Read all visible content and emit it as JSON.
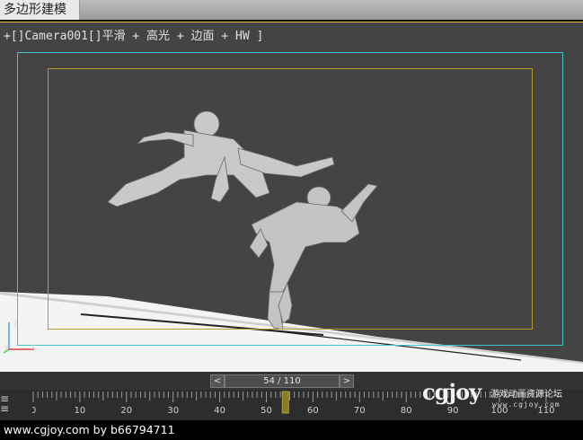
{
  "ribbon": {
    "active_tab": "多边形建模"
  },
  "viewport": {
    "label": "+[]Camera001[]平滑 + 高光 + 边面 + HW ]",
    "safe_frame_color": "#3fc3cf",
    "action_safe_color": "#b59a2e",
    "axes": {
      "z": "z",
      "y": "y",
      "x": "x"
    }
  },
  "timeline": {
    "prev_label": "<",
    "slider_text": "54 / 110",
    "next_label": ">",
    "current_frame": 54,
    "total_frames": 110,
    "ruler_numbers": [
      "0",
      "10",
      "20",
      "30",
      "40",
      "50",
      "60",
      "70",
      "80",
      "90",
      "100",
      "110"
    ]
  },
  "watermark": {
    "logo": "cgjoy",
    "subtitle": "游戏动画资源论坛",
    "url": "www.cgjoy.com"
  },
  "footer": {
    "text": "www.cgjoy.com by b66794711"
  }
}
